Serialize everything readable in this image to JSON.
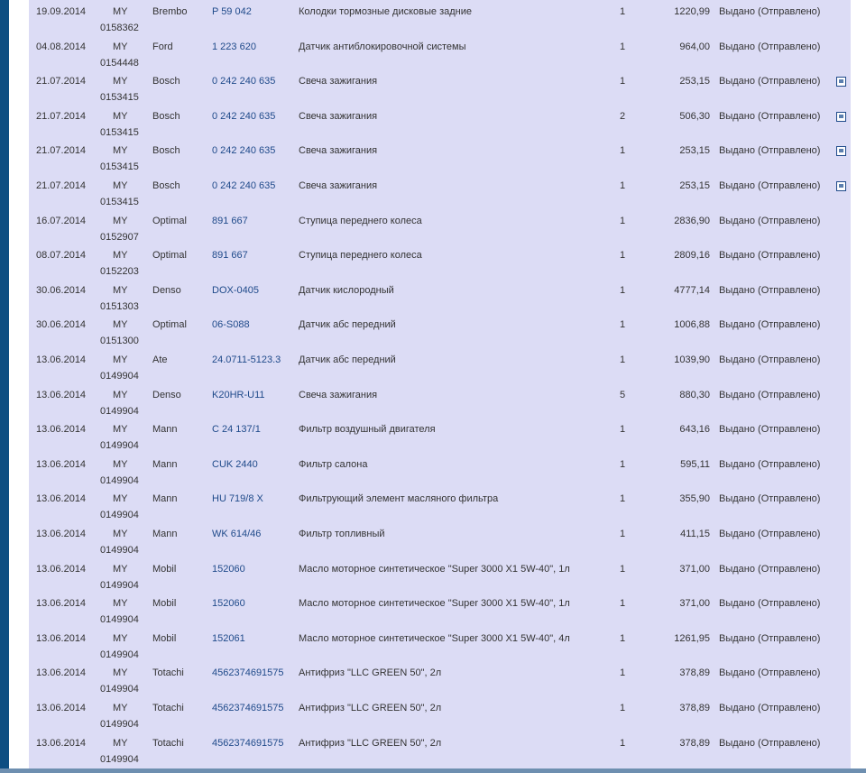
{
  "orders": [
    {
      "date": "19.09.2014",
      "order_prefix": "MY",
      "order_no": "0158362",
      "brand": "Brembo",
      "article": "P 59 042",
      "description": "Колодки тормозные дисковые задние",
      "qty": "1",
      "price": "1220,99",
      "status": "Выдано (Отправлено)",
      "has_icon": false
    },
    {
      "date": "04.08.2014",
      "order_prefix": "MY",
      "order_no": "0154448",
      "brand": "Ford",
      "article": "1 223 620",
      "description": "Датчик антиблокировочной системы",
      "qty": "1",
      "price": "964,00",
      "status": "Выдано (Отправлено)",
      "has_icon": false
    },
    {
      "date": "21.07.2014",
      "order_prefix": "MY",
      "order_no": "0153415",
      "brand": "Bosch",
      "article": "0 242 240 635",
      "description": "Свеча зажигания",
      "qty": "1",
      "price": "253,15",
      "status": "Выдано (Отправлено)",
      "has_icon": true
    },
    {
      "date": "21.07.2014",
      "order_prefix": "MY",
      "order_no": "0153415",
      "brand": "Bosch",
      "article": "0 242 240 635",
      "description": "Свеча зажигания",
      "qty": "2",
      "price": "506,30",
      "status": "Выдано (Отправлено)",
      "has_icon": true
    },
    {
      "date": "21.07.2014",
      "order_prefix": "MY",
      "order_no": "0153415",
      "brand": "Bosch",
      "article": "0 242 240 635",
      "description": "Свеча зажигания",
      "qty": "1",
      "price": "253,15",
      "status": "Выдано (Отправлено)",
      "has_icon": true
    },
    {
      "date": "21.07.2014",
      "order_prefix": "MY",
      "order_no": "0153415",
      "brand": "Bosch",
      "article": "0 242 240 635",
      "description": "Свеча зажигания",
      "qty": "1",
      "price": "253,15",
      "status": "Выдано (Отправлено)",
      "has_icon": true
    },
    {
      "date": "16.07.2014",
      "order_prefix": "MY",
      "order_no": "0152907",
      "brand": "Optimal",
      "article": "891 667",
      "description": "Ступица переднего колеса",
      "qty": "1",
      "price": "2836,90",
      "status": "Выдано (Отправлено)",
      "has_icon": false
    },
    {
      "date": "08.07.2014",
      "order_prefix": "MY",
      "order_no": "0152203",
      "brand": "Optimal",
      "article": "891 667",
      "description": "Ступица переднего колеса",
      "qty": "1",
      "price": "2809,16",
      "status": "Выдано (Отправлено)",
      "has_icon": false
    },
    {
      "date": "30.06.2014",
      "order_prefix": "MY",
      "order_no": "0151303",
      "brand": "Denso",
      "article": "DOX-0405",
      "description": "Датчик кислородный",
      "qty": "1",
      "price": "4777,14",
      "status": "Выдано (Отправлено)",
      "has_icon": false
    },
    {
      "date": "30.06.2014",
      "order_prefix": "MY",
      "order_no": "0151300",
      "brand": "Optimal",
      "article": "06-S088",
      "description": "Датчик абс передний",
      "qty": "1",
      "price": "1006,88",
      "status": "Выдано (Отправлено)",
      "has_icon": false
    },
    {
      "date": "13.06.2014",
      "order_prefix": "MY",
      "order_no": "0149904",
      "brand": "Ate",
      "article": "24.0711-5123.3",
      "description": "Датчик абс передний",
      "qty": "1",
      "price": "1039,90",
      "status": "Выдано (Отправлено)",
      "has_icon": false
    },
    {
      "date": "13.06.2014",
      "order_prefix": "MY",
      "order_no": "0149904",
      "brand": "Denso",
      "article": "K20HR-U11",
      "description": "Свеча зажигания",
      "qty": "5",
      "price": "880,30",
      "status": "Выдано (Отправлено)",
      "has_icon": false
    },
    {
      "date": "13.06.2014",
      "order_prefix": "MY",
      "order_no": "0149904",
      "brand": "Mann",
      "article": "C 24 137/1",
      "description": "Фильтр воздушный двигателя",
      "qty": "1",
      "price": "643,16",
      "status": "Выдано (Отправлено)",
      "has_icon": false
    },
    {
      "date": "13.06.2014",
      "order_prefix": "MY",
      "order_no": "0149904",
      "brand": "Mann",
      "article": "CUK 2440",
      "description": "Фильтр салона",
      "qty": "1",
      "price": "595,11",
      "status": "Выдано (Отправлено)",
      "has_icon": false
    },
    {
      "date": "13.06.2014",
      "order_prefix": "MY",
      "order_no": "0149904",
      "brand": "Mann",
      "article": "HU 719/8 X",
      "description": "Фильтрующий элемент масляного фильтра",
      "qty": "1",
      "price": "355,90",
      "status": "Выдано (Отправлено)",
      "has_icon": false
    },
    {
      "date": "13.06.2014",
      "order_prefix": "MY",
      "order_no": "0149904",
      "brand": "Mann",
      "article": "WK 614/46",
      "description": "Фильтр топливный",
      "qty": "1",
      "price": "411,15",
      "status": "Выдано (Отправлено)",
      "has_icon": false
    },
    {
      "date": "13.06.2014",
      "order_prefix": "MY",
      "order_no": "0149904",
      "brand": "Mobil",
      "article": "152060",
      "description": "Масло моторное синтетическое \"Super 3000 X1 5W-40\", 1л",
      "qty": "1",
      "price": "371,00",
      "status": "Выдано (Отправлено)",
      "has_icon": false
    },
    {
      "date": "13.06.2014",
      "order_prefix": "MY",
      "order_no": "0149904",
      "brand": "Mobil",
      "article": "152060",
      "description": "Масло моторное синтетическое \"Super 3000 X1 5W-40\", 1л",
      "qty": "1",
      "price": "371,00",
      "status": "Выдано (Отправлено)",
      "has_icon": false
    },
    {
      "date": "13.06.2014",
      "order_prefix": "MY",
      "order_no": "0149904",
      "brand": "Mobil",
      "article": "152061",
      "description": "Масло моторное синтетическое \"Super 3000 X1 5W-40\", 4л",
      "qty": "1",
      "price": "1261,95",
      "status": "Выдано (Отправлено)",
      "has_icon": false
    },
    {
      "date": "13.06.2014",
      "order_prefix": "MY",
      "order_no": "0149904",
      "brand": "Totachi",
      "article": "4562374691575",
      "description": "Антифриз \"LLC GREEN 50\", 2л",
      "qty": "1",
      "price": "378,89",
      "status": "Выдано (Отправлено)",
      "has_icon": false
    },
    {
      "date": "13.06.2014",
      "order_prefix": "MY",
      "order_no": "0149904",
      "brand": "Totachi",
      "article": "4562374691575",
      "description": "Антифриз \"LLC GREEN 50\", 2л",
      "qty": "1",
      "price": "378,89",
      "status": "Выдано (Отправлено)",
      "has_icon": false
    },
    {
      "date": "13.06.2014",
      "order_prefix": "MY",
      "order_no": "0149904",
      "brand": "Totachi",
      "article": "4562374691575",
      "description": "Антифриз \"LLC GREEN 50\", 2л",
      "qty": "1",
      "price": "378,89",
      "status": "Выдано (Отправлено)",
      "has_icon": false
    }
  ]
}
